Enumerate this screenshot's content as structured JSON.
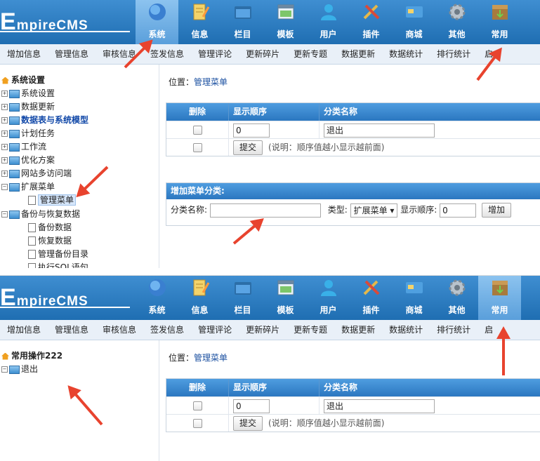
{
  "brand": {
    "logo_big": "E",
    "logo_rest": "mpireCMS"
  },
  "nav": [
    {
      "label": "系统",
      "icon": "globe-icon",
      "color": "#3a7fd0"
    },
    {
      "label": "信息",
      "icon": "notepad-icon",
      "color": "#f3d36b"
    },
    {
      "label": "栏目",
      "icon": "folder-icon",
      "color": "#2c6ea8"
    },
    {
      "label": "模板",
      "icon": "window-icon",
      "color": "#7dc66a"
    },
    {
      "label": "用户",
      "icon": "user-icon",
      "color": "#39b0e8"
    },
    {
      "label": "插件",
      "icon": "tools-icon",
      "color": "#e5b84a"
    },
    {
      "label": "商城",
      "icon": "card-icon",
      "color": "#4fa0e0"
    },
    {
      "label": "其他",
      "icon": "gear-icon",
      "color": "#b9c3cc"
    },
    {
      "label": "常用",
      "icon": "box-icon",
      "color": "#a77a3d"
    }
  ],
  "subnav": [
    "增加信息",
    "管理信息",
    "审核信息",
    "签发信息",
    "管理评论",
    "更新碎片",
    "更新专题",
    "数据更新",
    "数据统计",
    "排行统计",
    "启"
  ],
  "screen1": {
    "tree_root": "系统设置",
    "tree": [
      {
        "label": "系统设置",
        "pm": "+"
      },
      {
        "label": "数据更新",
        "pm": "+"
      },
      {
        "label": "数据表与系统模型",
        "pm": "+"
      },
      {
        "label": "计划任务",
        "pm": "+"
      },
      {
        "label": "工作流",
        "pm": "+"
      },
      {
        "label": "优化方案",
        "pm": "+"
      },
      {
        "label": "网站多访问端",
        "pm": "+"
      },
      {
        "label": "扩展菜单",
        "pm": "−"
      }
    ],
    "tree_child_menu": "管理菜单",
    "tree_backup": "备份与恢复数据",
    "tree_backup_children": [
      "备份数据",
      "恢复数据",
      "管理备份目录",
      "执行SQL语句"
    ]
  },
  "screen2": {
    "tree_root": "常用操作222",
    "tree": [
      {
        "label": "退出",
        "pm": "−"
      }
    ]
  },
  "content": {
    "breadcrumb_label": "位置：",
    "breadcrumb_link": "管理菜单",
    "table_headers": [
      "删除",
      "显示顺序",
      "分类名称"
    ],
    "row_order": "0",
    "row_name": "退出",
    "submit_label": "提交",
    "note": "(说明：顺序值越小显示越前面)",
    "add_title": "增加菜单分类:",
    "add_name_label": "分类名称:",
    "add_type_label": "类型:",
    "add_type_value": "扩展菜单",
    "add_order_label": "显示顺序:",
    "add_order_value": "0",
    "add_button": "增加"
  },
  "colors": {
    "header": "#2b7bc4",
    "arrow": "#e8432e",
    "link": "#1a4fa0"
  }
}
